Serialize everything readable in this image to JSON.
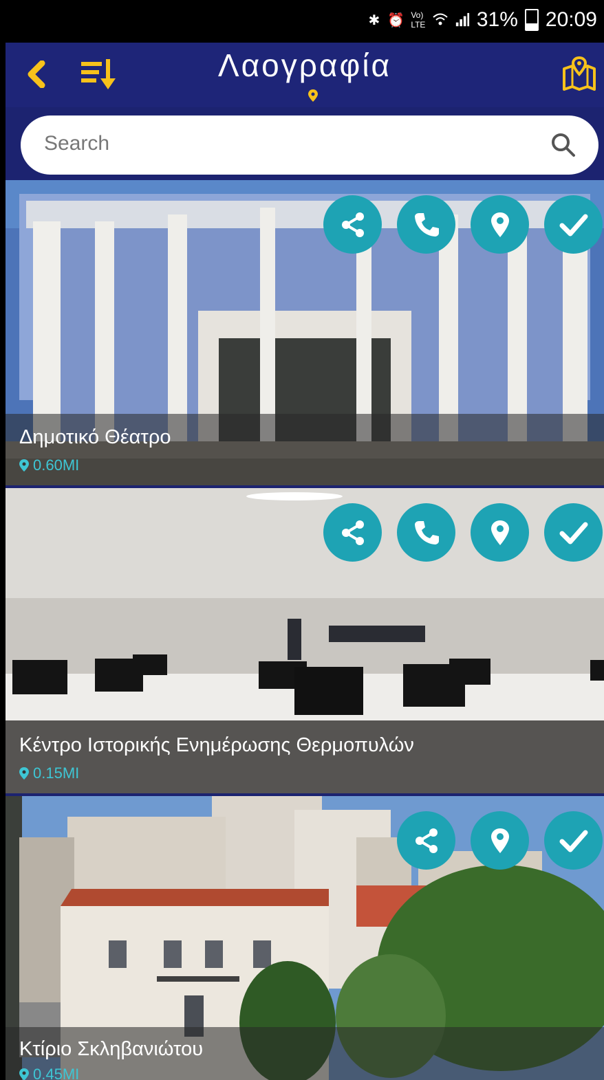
{
  "status_bar": {
    "battery": "31%",
    "time": "20:09"
  },
  "app_bar": {
    "title": "Λαογραφία"
  },
  "search": {
    "placeholder": "Search"
  },
  "places": [
    {
      "name": "Δημοτικό Θέατρο",
      "distance": "0.60MI",
      "actions": [
        "share",
        "call",
        "location",
        "check"
      ]
    },
    {
      "name": "Κέντρο Ιστορικής Ενημέρωσης Θερμοπυλών",
      "distance": "0.15MI",
      "actions": [
        "share",
        "call",
        "location",
        "check"
      ]
    },
    {
      "name": "Κτίριο Σκληβανιώτου",
      "distance": "0.45MI",
      "actions": [
        "share",
        "location",
        "check"
      ]
    }
  ],
  "colors": {
    "app_bar": "#1e2578",
    "accent_yellow": "#f7c21b",
    "action_teal": "#1ea3b4",
    "distance_teal": "#3ec6d4"
  }
}
